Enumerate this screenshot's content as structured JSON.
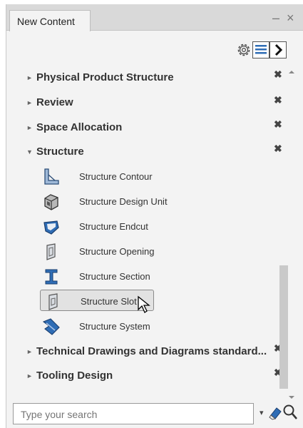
{
  "tab": {
    "label": "New Content"
  },
  "window": {
    "minimize": "–",
    "close": "×"
  },
  "toolbar": {
    "settings_icon": "gear-icon",
    "list_icon": "list-view-icon",
    "expand_icon": "chevron-right-icon"
  },
  "categories": [
    {
      "label": "Physical Product Structure",
      "expanded": false,
      "close": "✖"
    },
    {
      "label": "Review",
      "expanded": false,
      "close": "✖"
    },
    {
      "label": "Space Allocation",
      "expanded": false,
      "close": "✖"
    },
    {
      "label": "Structure",
      "expanded": true,
      "close": "✖"
    },
    {
      "label": "Technical Drawings and Diagrams standard...",
      "expanded": false,
      "close": "✖"
    },
    {
      "label": "Tooling Design",
      "expanded": false,
      "close": "✖"
    }
  ],
  "structure_items": [
    {
      "label": "Structure Contour",
      "icon": "structure-contour-icon"
    },
    {
      "label": "Structure Design Unit",
      "icon": "structure-design-unit-icon"
    },
    {
      "label": "Structure Endcut",
      "icon": "structure-endcut-icon"
    },
    {
      "label": "Structure Opening",
      "icon": "structure-opening-icon"
    },
    {
      "label": "Structure Section",
      "icon": "structure-section-icon"
    },
    {
      "label": "Structure Slot",
      "icon": "structure-slot-icon",
      "selected": true
    },
    {
      "label": "Structure System",
      "icon": "structure-system-icon"
    }
  ],
  "search": {
    "placeholder": "Type your search",
    "dropdown": "▾"
  },
  "tri": {
    "collapsed": "►",
    "expanded": "▼"
  },
  "colors": {
    "panel_bg": "#f3f3f3",
    "tabbar_bg": "#d9d9d9",
    "selected_bg": "#e2e2e2",
    "icon_blue": "#2f6db5"
  }
}
